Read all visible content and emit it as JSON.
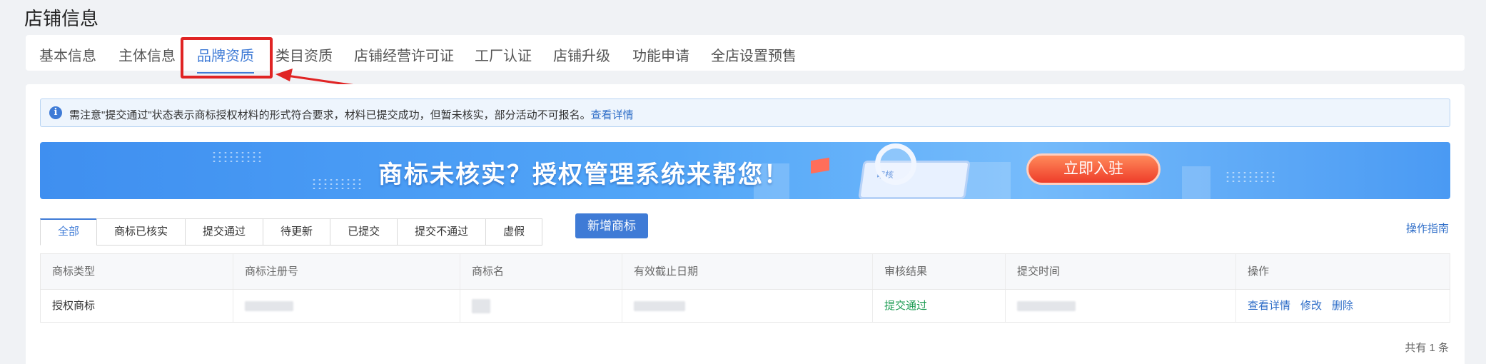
{
  "page": {
    "title": "店铺信息"
  },
  "tabs": [
    {
      "label": "基本信息"
    },
    {
      "label": "主体信息"
    },
    {
      "label": "品牌资质",
      "active": true
    },
    {
      "label": "类目资质"
    },
    {
      "label": "店铺经营许可证"
    },
    {
      "label": "工厂认证"
    },
    {
      "label": "店铺升级"
    },
    {
      "label": "功能申请"
    },
    {
      "label": "全店设置预售"
    }
  ],
  "notice": {
    "icon": "info-icon",
    "text": "需注意\"提交通过\"状态表示商标授权材料的形式符合要求，材料已提交成功，但暂未核实，部分活动不可报名。",
    "link": "查看详情"
  },
  "banner": {
    "slogan": "商标未核实？授权管理系统来帮您！",
    "cta": "立即入驻",
    "chip": "审核"
  },
  "filters": [
    "全部",
    "商标已核实",
    "提交通过",
    "待更新",
    "已提交",
    "提交不通过",
    "虚假"
  ],
  "actions": {
    "add_button": "新增商标",
    "guide_link": "操作指南"
  },
  "table": {
    "headers": [
      "商标类型",
      "商标注册号",
      "商标名",
      "有效截止日期",
      "审核结果",
      "提交时间",
      "操作"
    ],
    "row": {
      "type": "授权商标",
      "result": "提交通过",
      "ops": [
        "查看详情",
        "修改",
        "删除"
      ]
    }
  },
  "footer": {
    "total": "共有 1 条"
  },
  "colors": {
    "accent": "#3f7bd6",
    "annotation": "#e02424",
    "success": "#1f9d55"
  }
}
